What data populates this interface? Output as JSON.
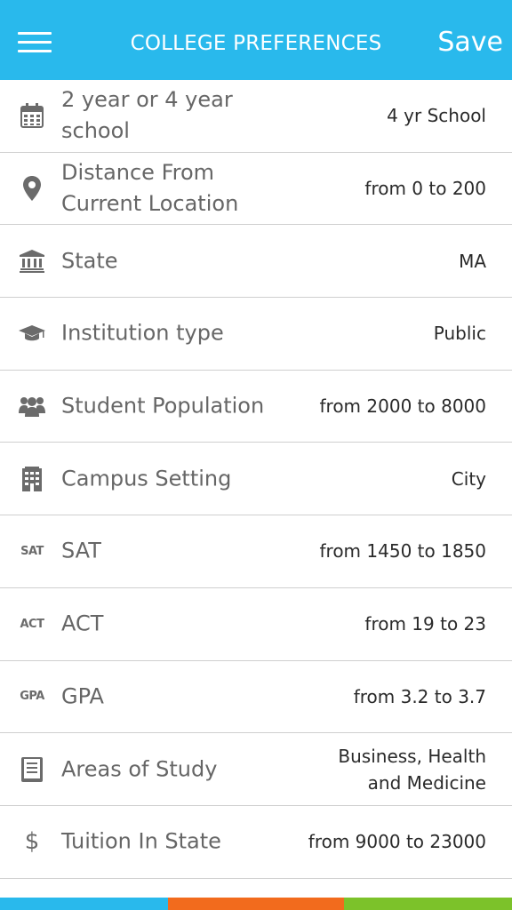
{
  "header": {
    "title": "COLLEGE PREFERENCES",
    "save_label": "Save",
    "color": "#29b9ec"
  },
  "rows": [
    {
      "icon": "calendar-icon",
      "label": "2 year or 4 year school",
      "value": "4 yr School"
    },
    {
      "icon": "location-pin-icon",
      "label": "Distance From Current Location",
      "value": "from 0 to 200"
    },
    {
      "icon": "bank-icon",
      "label": "State",
      "value": "MA"
    },
    {
      "icon": "graduation-cap-icon",
      "label": "Institution type",
      "value": "Public"
    },
    {
      "icon": "users-icon",
      "label": "Student Population",
      "value": "from 2000 to 8000"
    },
    {
      "icon": "building-icon",
      "label": "Campus Setting",
      "value": "City"
    },
    {
      "icon": "sat-icon",
      "icon_text": "SAT",
      "label": "SAT",
      "value": "from 1450 to 1850"
    },
    {
      "icon": "act-icon",
      "icon_text": "ACT",
      "label": "ACT",
      "value": "from 19 to 23"
    },
    {
      "icon": "gpa-icon",
      "icon_text": "GPA",
      "label": "GPA",
      "value": "from 3.2 to 3.7"
    },
    {
      "icon": "book-icon",
      "label": "Areas of Study",
      "value": "Business, Health and Medicine"
    },
    {
      "icon": "dollar-icon",
      "icon_text": "$",
      "label": "Tuition In State",
      "value": "from 9000 to 23000"
    }
  ],
  "bottom_bar_colors": [
    "#29b9ec",
    "#f26b1d",
    "#7cc22a"
  ]
}
